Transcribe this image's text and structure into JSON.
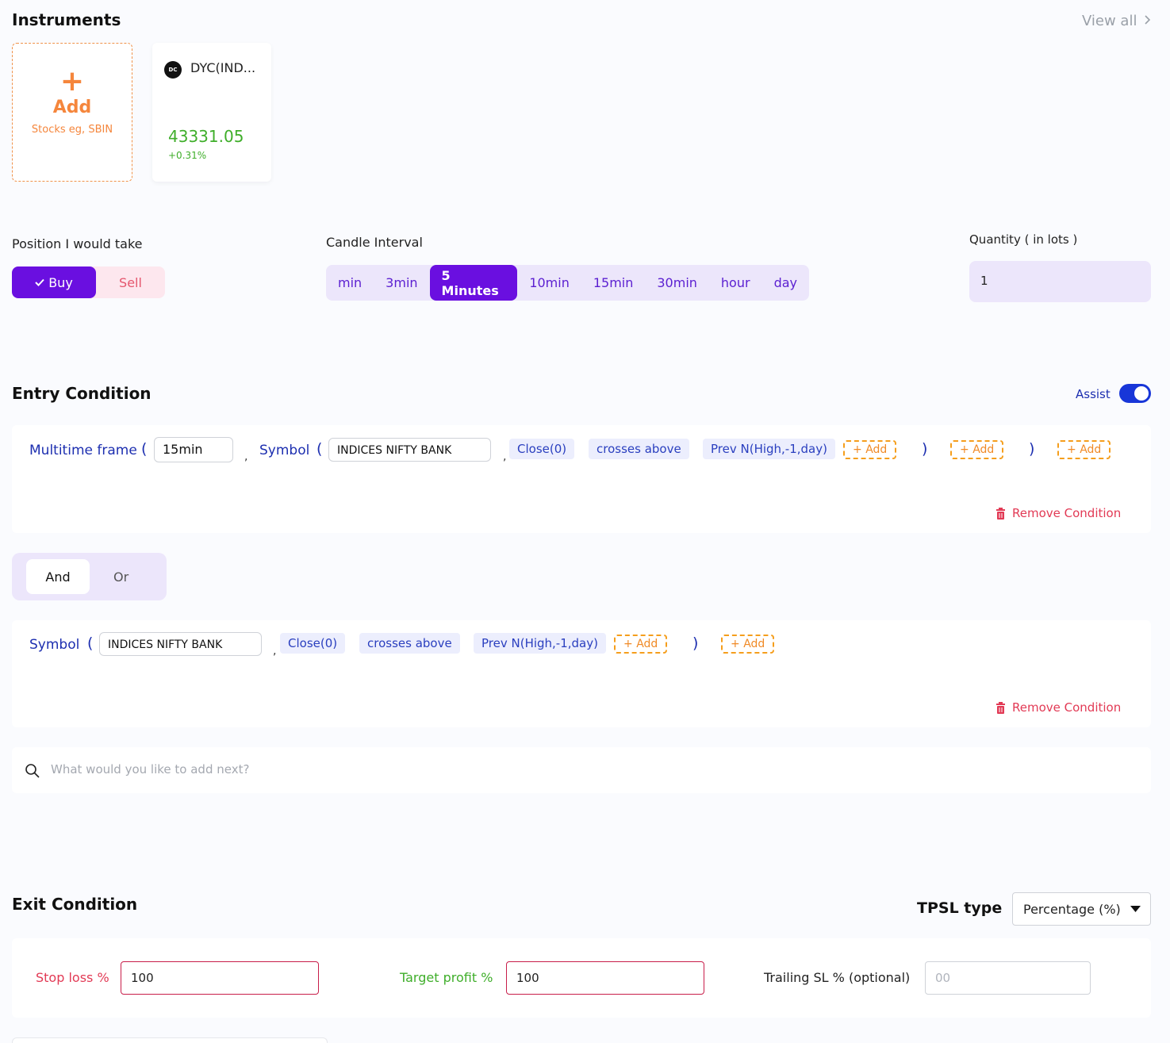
{
  "instruments": {
    "title": "Instruments",
    "view_all": "View all",
    "add_card": {
      "plus": "+",
      "label": "Add",
      "sub": "Stocks eg, SBIN"
    },
    "card": {
      "logo": "DC",
      "name": "DYC(IND...",
      "price": "43331.05",
      "change": "+0.31%"
    }
  },
  "position": {
    "label": "Position I would take",
    "buy": "Buy",
    "sell": "Sell",
    "selected": "Buy"
  },
  "candle": {
    "label": "Candle Interval",
    "options": [
      "min",
      "3min",
      "5 Minutes",
      "10min",
      "15min",
      "30min",
      "hour",
      "day"
    ],
    "selected": "5 Minutes"
  },
  "quantity": {
    "label": "Quantity ( in lots )",
    "value": "1"
  },
  "entry": {
    "title": "Entry Condition",
    "assist_label": "Assist",
    "assist_on": true,
    "condition1": {
      "mtf_label": "Multitime frame",
      "mtf_value": "15min",
      "symbol_label": "Symbol",
      "symbol_value": "INDICES NIFTY BANK",
      "close": "Close(0)",
      "op": "crosses above",
      "prev": "Prev N(High,-1,day)",
      "add": "Add",
      "remove": "Remove Condition"
    },
    "logic": {
      "and": "And",
      "or": "Or",
      "selected": "And"
    },
    "condition2": {
      "symbol_label": "Symbol",
      "symbol_value": "INDICES NIFTY BANK",
      "close": "Close(0)",
      "op": "crosses above",
      "prev": "Prev N(High,-1,day)",
      "add": "Add",
      "remove": "Remove Condition"
    },
    "search_placeholder": "What would you like to add next?"
  },
  "exit": {
    "title": "Exit Condition",
    "tpsl_label": "TPSL type",
    "tpsl_value": "Percentage (%)",
    "stop_loss_label": "Stop loss %",
    "stop_loss_value": "100",
    "target_label": "Target profit %",
    "target_value": "100",
    "trailing_label": "Trailing SL % (optional)",
    "trailing_placeholder": "00"
  },
  "colors": {
    "primary": "#6a0fe0",
    "accent_orange": "#f5863c",
    "positive": "#3fae2a",
    "danger": "#e23a55",
    "link_blue": "#1d2fb0"
  }
}
